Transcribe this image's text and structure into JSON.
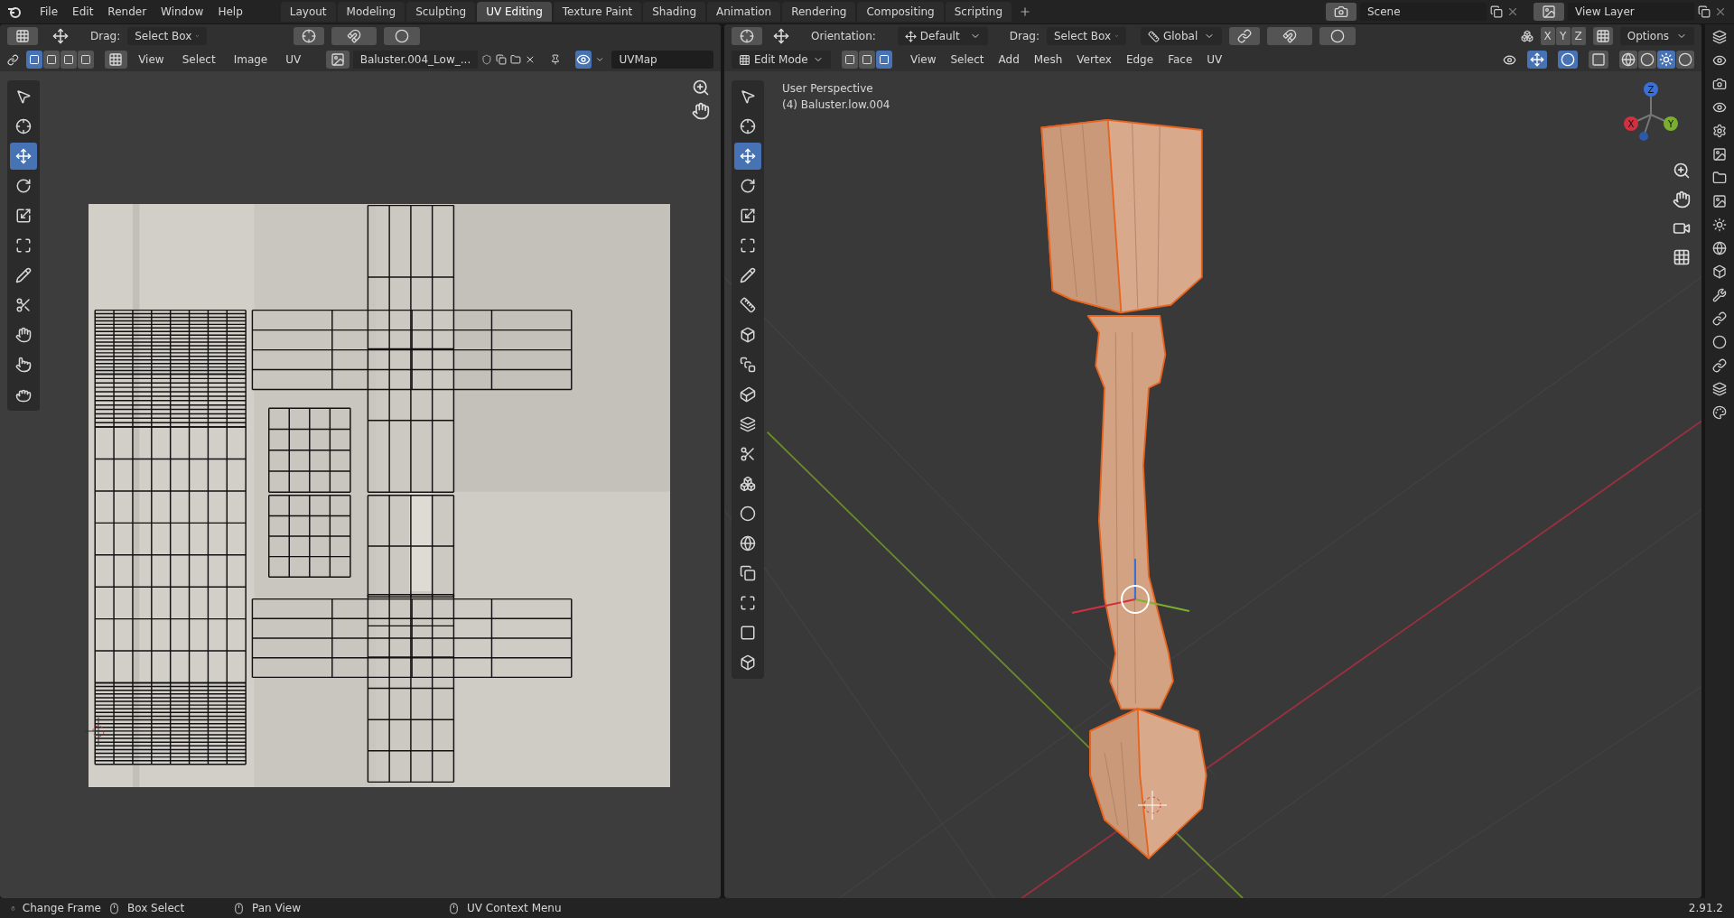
{
  "menu": [
    "File",
    "Edit",
    "Render",
    "Window",
    "Help"
  ],
  "workspaces": [
    {
      "label": "Layout",
      "selected": false
    },
    {
      "label": "Modeling",
      "selected": false
    },
    {
      "label": "Sculpting",
      "selected": false
    },
    {
      "label": "UV Editing",
      "selected": true
    },
    {
      "label": "Texture Paint",
      "selected": false
    },
    {
      "label": "Shading",
      "selected": false
    },
    {
      "label": "Animation",
      "selected": false
    },
    {
      "label": "Rendering",
      "selected": false
    },
    {
      "label": "Compositing",
      "selected": false
    },
    {
      "label": "Scripting",
      "selected": false
    }
  ],
  "scene": "Scene",
  "view_layer": "View Layer",
  "uv_editor": {
    "drag_label": "Drag:",
    "drag_value": "Select Box",
    "select_modes": [
      {
        "selected": true
      },
      {
        "selected": false
      },
      {
        "selected": false
      },
      {
        "selected": false
      }
    ],
    "menus": [
      "View",
      "Select",
      "Image",
      "UV"
    ],
    "image_name": "Baluster.004_Low_...",
    "uv_map": "UVMap",
    "tools": [
      {
        "selected": false
      },
      {
        "selected": false
      },
      {
        "selected": true
      },
      {
        "selected": false
      },
      {
        "selected": false
      },
      {
        "selected": false
      },
      {
        "selected": false
      },
      {
        "selected": false
      },
      {
        "selected": false
      },
      {
        "selected": false
      },
      {
        "selected": false
      }
    ]
  },
  "viewport": {
    "orientation_label": "Orientation:",
    "orientation_value": "Default",
    "drag_label": "Drag:",
    "drag_value": "Select Box",
    "transform_orientation": "Global",
    "mirror_axes": [
      "X",
      "Y",
      "Z"
    ],
    "options": "Options",
    "mode": "Edit Mode",
    "select_modes": [
      {
        "selected": false
      },
      {
        "selected": false
      },
      {
        "selected": true
      }
    ],
    "menus": [
      "View",
      "Select",
      "Add",
      "Mesh",
      "Vertex",
      "Edge",
      "Face",
      "UV"
    ],
    "view_name": "User Perspective",
    "object_info": "(4) Baluster.low.004",
    "gizmo_axes": [
      "X",
      "Y",
      "Z"
    ],
    "tools": [
      {
        "selected": false
      },
      {
        "selected": false
      },
      {
        "selected": true
      },
      {
        "selected": false
      },
      {
        "selected": false
      },
      {
        "selected": false
      },
      {
        "selected": false
      },
      {
        "selected": false
      },
      {
        "selected": false
      },
      {
        "selected": false
      },
      {
        "selected": false
      },
      {
        "selected": false
      },
      {
        "selected": false
      },
      {
        "selected": false
      },
      {
        "selected": false
      },
      {
        "selected": false
      },
      {
        "selected": false
      },
      {
        "selected": false
      },
      {
        "selected": false
      },
      {
        "selected": false
      }
    ]
  },
  "status_bar": {
    "items": [
      "Change Frame",
      "Box Select",
      "Pan View",
      "UV Context Menu"
    ],
    "version": "2.91.2"
  }
}
